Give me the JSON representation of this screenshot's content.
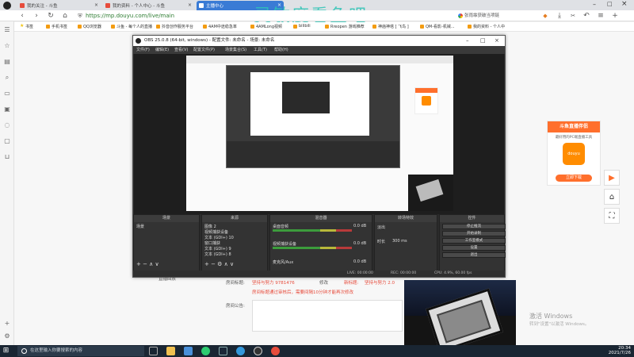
{
  "browser": {
    "tabs": [
      {
        "label": "我的关注 - 斗鱼",
        "active": false
      },
      {
        "label": "我的资料 - 个人中心 - 斗鱼",
        "active": false
      },
      {
        "label": "主播中心",
        "active": true
      }
    ],
    "url": "https://mp.douyu.com/live/main",
    "search_placeholder": "张雨霏获破当项链",
    "bookmarks": [
      "书签",
      "手机书签",
      "QQ浏览器",
      "斗鱼 - 每个人的直播",
      "抖音创作服务平台",
      "4AM中途稳急率",
      "4AMLong视频",
      "bilibili",
      "Rreopen 游戏推荐",
      "神庙神塔 [ 飞鸟 ]",
      "QM-看影-机械...",
      "我的资料 - 个人中"
    ]
  },
  "overlay_text": "灵敏度看鱼吧",
  "obs": {
    "title": "OBS 25.0.8 (64-bit, windows) - 配置文件: 未命名 - 场景: 未命名",
    "menu": [
      "文件(F)",
      "编辑(E)",
      "查看(V)",
      "配置文件(P)",
      "场景集合(S)",
      "工具(T)",
      "帮助(H)"
    ],
    "docks": {
      "scenes": {
        "title": "场景",
        "items": [
          "场景"
        ]
      },
      "sources": {
        "title": "来源",
        "items": [
          "图像 2",
          "视频捕获设备",
          "文本 (GDI+) 10",
          "窗口捕获",
          "文本 (GDI+) 9",
          "文本 (GDI+) 8"
        ]
      },
      "mixer": {
        "title": "混音器",
        "channels": [
          {
            "name": "桌面音频",
            "db": "0.0 dB"
          },
          {
            "name": "视频捕获设备",
            "db": "0.0 dB"
          },
          {
            "name": "麦克风/Aux",
            "db": "0.0 dB"
          }
        ]
      },
      "transitions": {
        "title": "转场特效",
        "type": "淡出",
        "duration_label": "时长",
        "duration": "300 ms"
      },
      "controls": {
        "title": "控件",
        "buttons": [
          "停止推流",
          "开始录制",
          "工作室模式",
          "设置",
          "退出"
        ]
      }
    },
    "status": {
      "live": "LIVE: 00:00:00",
      "rec": "REC: 00:00:00",
      "cpu": "CPU: 4.9%, 60.00 fps"
    }
  },
  "douyu_widget": {
    "title": "斗鱼直播伴侣",
    "subtitle": "最好用的PC端直播工具",
    "logo": "douyu",
    "button": "立即下载"
  },
  "page": {
    "room_title_label": "房间标题:",
    "room_title_value": "坚持与努力 9781476",
    "edit": "修改",
    "new_title_label": "新标题:",
    "new_title_value": "坚持与努力 2.0",
    "note": "房间标题通过审核后，需要间隔10分钟才能再次修改",
    "announcement_label": "房间公告:",
    "live_record": "直播回放"
  },
  "windows_activate": {
    "title": "激活 Windows",
    "subtitle": "转到\"设置\"以激活 Windows。"
  },
  "taskbar": {
    "search_placeholder": "在这里输入你要搜索的内容",
    "time": "20:34",
    "date": "2021/7/26"
  }
}
